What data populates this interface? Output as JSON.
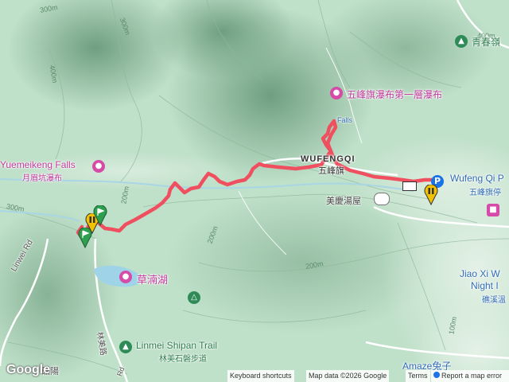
{
  "map": {
    "labels": {
      "yuemeikeng_en": "Yuemeikeng Falls",
      "yuemeikeng_zh": "月眉坑瀑布",
      "wufengqi_fall": "五峰旗瀑布第一層瀑布",
      "wufengqi_area_en": "WUFENGQI",
      "wufengqi_area_zh": "五峰旗",
      "meiqing": "美慶湯屋",
      "wufengqi_park_en": "Wufeng Qi P",
      "wufengqi_park_zh": "五峰旗停",
      "qingchun": "青春嶺",
      "caotihu": "草湳湖",
      "linmei_en": "Linmei Shipan Trail",
      "linmei_zh": "林美石磐步道",
      "jiaoxi_en1": "Jiao Xi W",
      "jiaoxi_en2": "Night I",
      "jiaoxi_zh": "礁溪溫",
      "amaze": "Amaze兔子",
      "linwei_rd": "Linwei Rd",
      "linmei_rd": "林美路",
      "trail_fragment": "Falls",
      "bottom_left": "礁陽",
      "bottom_rd": "Rd"
    },
    "contours": [
      "300m",
      "400m",
      "300m",
      "200m",
      "200m",
      "300m",
      "400m",
      "200m",
      "100m"
    ],
    "icons": {
      "attraction": "camera-icon",
      "park": "tree-icon",
      "hotel": "bed-icon",
      "parking": "P",
      "hiking": "hiker-icon",
      "start_flag": "flag-icon",
      "pause_marker": "pause-icon"
    },
    "colors": {
      "route": "#ef4f5f",
      "attraction_pin": "#d64aa8",
      "park_pin": "#2e8b57",
      "parking_pin": "#1a73e8",
      "terrain": "#bfe0c9"
    }
  },
  "footer": {
    "logo": "Google",
    "shortcuts": "Keyboard shortcuts",
    "mapdata": "Map data ©2026 Google",
    "terms": "Terms",
    "report": "Report a map error"
  }
}
